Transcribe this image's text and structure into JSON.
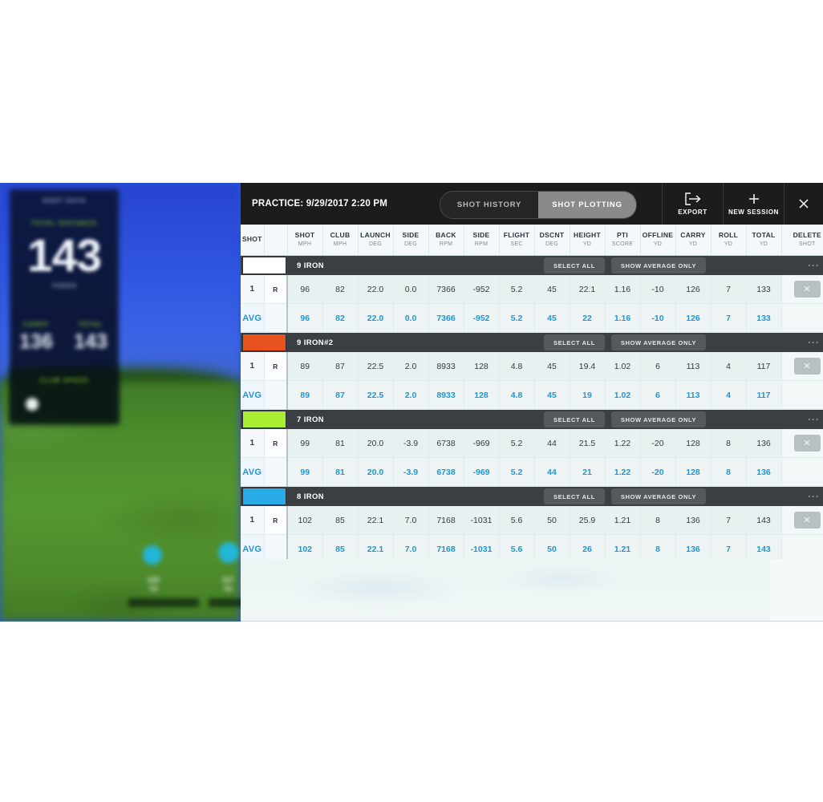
{
  "header": {
    "session_title": "PRACTICE: 9/29/2017 2:20 PM",
    "tabs": [
      {
        "label": "SHOT HISTORY",
        "active": false
      },
      {
        "label": "SHOT PLOTTING",
        "active": true
      }
    ],
    "actions": [
      {
        "label": "EXPORT",
        "icon": "export-icon"
      },
      {
        "label": "NEW SESSION",
        "icon": "plus-icon"
      }
    ],
    "close_icon": "close-icon"
  },
  "table": {
    "columns": [
      {
        "key": "shot_no",
        "main": "SHOT",
        "unit": ""
      },
      {
        "key": "hand",
        "main": "",
        "unit": ""
      },
      {
        "key": "shot_mph",
        "main": "SHOT",
        "unit": "MPH"
      },
      {
        "key": "club_mph",
        "main": "CLUB",
        "unit": "MPH"
      },
      {
        "key": "launch",
        "main": "LAUNCH",
        "unit": "DEG"
      },
      {
        "key": "side_deg",
        "main": "SIDE",
        "unit": "DEG"
      },
      {
        "key": "back_rpm",
        "main": "BACK",
        "unit": "RPM"
      },
      {
        "key": "side_rpm",
        "main": "SIDE",
        "unit": "RPM"
      },
      {
        "key": "flight",
        "main": "FLIGHT",
        "unit": "SEC"
      },
      {
        "key": "dscnt",
        "main": "DSCNT",
        "unit": "DEG"
      },
      {
        "key": "height",
        "main": "HEIGHT",
        "unit": "YD"
      },
      {
        "key": "pti",
        "main": "PTI",
        "unit": "SCORE"
      },
      {
        "key": "offline",
        "main": "OFFLINE",
        "unit": "YD"
      },
      {
        "key": "carry",
        "main": "CARRY",
        "unit": "YD"
      },
      {
        "key": "roll",
        "main": "ROLL",
        "unit": "YD"
      },
      {
        "key": "total",
        "main": "TOTAL",
        "unit": "YD"
      },
      {
        "key": "delete",
        "main": "DELETE",
        "unit": "SHOT"
      }
    ],
    "group_buttons": {
      "select_all": "SELECT ALL",
      "show_average_only": "SHOW AVERAGE ONLY",
      "overflow": "···"
    },
    "avg_label": "AVG",
    "delete_glyph": "✕",
    "groups": [
      {
        "name": "9 IRON",
        "color": "#ffffff",
        "shots": [
          {
            "no": "1",
            "hand": "R",
            "vals": [
              "96",
              "82",
              "22.0",
              "0.0",
              "7366",
              "-952",
              "5.2",
              "45",
              "22.1",
              "1.16",
              "-10",
              "126",
              "7",
              "133"
            ]
          }
        ],
        "avg": [
          "96",
          "82",
          "22.0",
          "0.0",
          "7366",
          "-952",
          "5.2",
          "45",
          "22",
          "1.16",
          "-10",
          "126",
          "7",
          "133"
        ]
      },
      {
        "name": "9 IRON#2",
        "color": "#e8521e",
        "shots": [
          {
            "no": "1",
            "hand": "R",
            "vals": [
              "89",
              "87",
              "22.5",
              "2.0",
              "8933",
              "128",
              "4.8",
              "45",
              "19.4",
              "1.02",
              "6",
              "113",
              "4",
              "117"
            ]
          }
        ],
        "avg": [
          "89",
          "87",
          "22.5",
          "2.0",
          "8933",
          "128",
          "4.8",
          "45",
          "19",
          "1.02",
          "6",
          "113",
          "4",
          "117"
        ]
      },
      {
        "name": "7 IRON",
        "color": "#aaee33",
        "shots": [
          {
            "no": "1",
            "hand": "R",
            "vals": [
              "99",
              "81",
              "20.0",
              "-3.9",
              "6738",
              "-969",
              "5.2",
              "44",
              "21.5",
              "1.22",
              "-20",
              "128",
              "8",
              "136"
            ]
          }
        ],
        "avg": [
          "99",
          "81",
          "20.0",
          "-3.9",
          "6738",
          "-969",
          "5.2",
          "44",
          "21",
          "1.22",
          "-20",
          "128",
          "8",
          "136"
        ]
      },
      {
        "name": "8 IRON",
        "color": "#29abe8",
        "shots": [
          {
            "no": "1",
            "hand": "R",
            "vals": [
              "102",
              "85",
              "22.1",
              "7.0",
              "7168",
              "-1031",
              "5.6",
              "50",
              "25.9",
              "1.21",
              "8",
              "136",
              "7",
              "143"
            ]
          }
        ],
        "avg": [
          "102",
          "85",
          "22.1",
          "7.0",
          "7168",
          "-1031",
          "5.6",
          "50",
          "26",
          "1.21",
          "8",
          "136",
          "7",
          "143"
        ]
      }
    ]
  },
  "simulator": {
    "hud": {
      "title": "SHOT DATA",
      "primary_label": "TOTAL DISTANCE",
      "primary_value": "143",
      "primary_unit": "YARDS",
      "secondary": [
        {
          "label": "CARRY",
          "value": "136"
        },
        {
          "label": "TOTAL",
          "value": "143"
        }
      ],
      "footer_label": "CLUB SPEED"
    },
    "markers": [
      {
        "value": "133",
        "unit": "YD"
      },
      {
        "value": "117",
        "unit": "YD"
      }
    ]
  },
  "colors": {
    "accent_blue": "#2196d4",
    "topbar_bg": "#1c1c1c",
    "group_bg": "#3a3f44"
  }
}
